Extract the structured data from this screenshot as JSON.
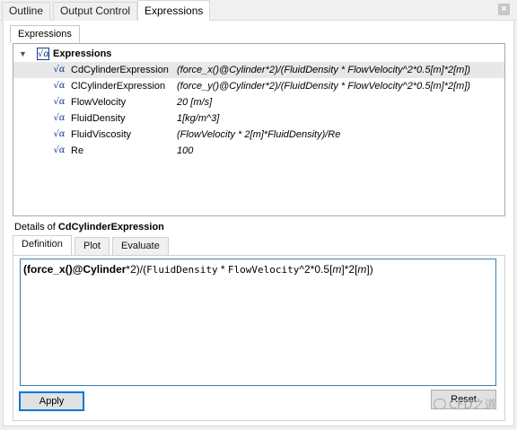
{
  "tabs": {
    "outline": "Outline",
    "output_control": "Output Control",
    "expressions": "Expressions",
    "close": "×"
  },
  "subtab": "Expressions",
  "tree": {
    "root_icon": "√α",
    "root_label": "Expressions",
    "rows": [
      {
        "name": "CdCylinderExpression",
        "value": "(force_x()@Cylinder*2)/(FluidDensity * FlowVelocity^2*0.5[m]*2[m])"
      },
      {
        "name": "ClCylinderExpression",
        "value": "(force_y()@Cylinder*2)/(FluidDensity * FlowVelocity^2*0.5[m]*2[m])"
      },
      {
        "name": "FlowVelocity",
        "value": "20 [m/s]"
      },
      {
        "name": "FluidDensity",
        "value": "1[kg/m^3]"
      },
      {
        "name": "FluidViscosity",
        "value": "(FlowVelocity * 2[m]*FluidDensity)/Re"
      },
      {
        "name": "Re",
        "value": "100"
      }
    ]
  },
  "details": {
    "prefix": "Details of ",
    "name": "CdCylinderExpression"
  },
  "detail_tabs": [
    "Definition",
    "Plot",
    "Evaluate"
  ],
  "editor": {
    "p1": "(",
    "p2": "force_x",
    "p3": "()",
    "p4": "@",
    "p5": "Cylinder",
    "p6": "*2)/(",
    "p7": "FluidDensity",
    "p8": " * ",
    "p9": "FlowVelocity",
    "p10": "^2*0.5[",
    "p11": "m",
    "p12": "]*2[",
    "p13": "m",
    "p14": "])"
  },
  "buttons": {
    "apply": "Apply",
    "reset": "Reset"
  },
  "watermark": "CFD之道"
}
